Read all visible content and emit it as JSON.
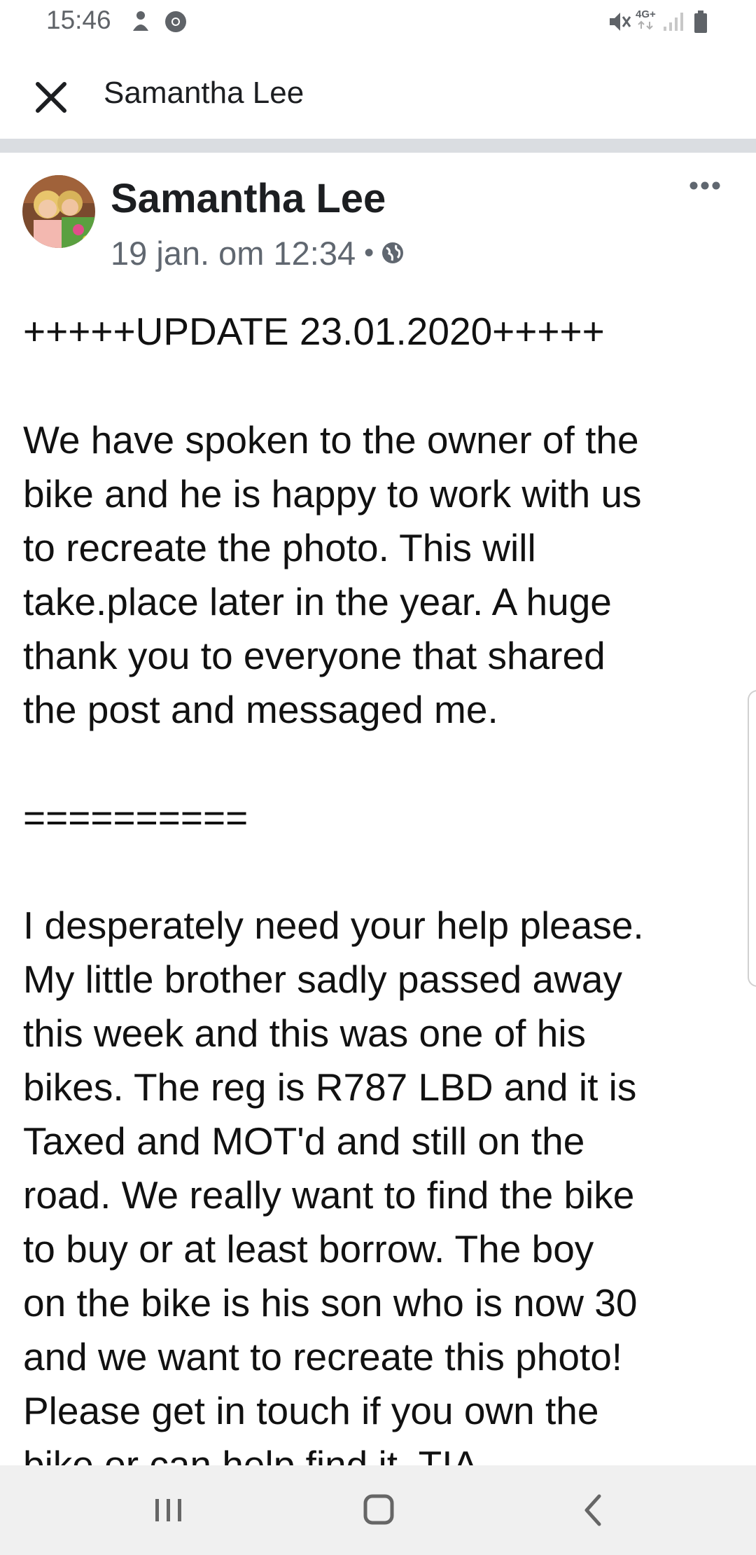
{
  "status_bar": {
    "time": "15:46",
    "left_icons": [
      "notification-icon",
      "chrome-icon"
    ],
    "right_icons": [
      "mute-icon",
      "network-4g-icon",
      "signal-icon",
      "battery-icon"
    ],
    "network_label": "4G+"
  },
  "header": {
    "close_icon": "close-icon",
    "title": "Samantha Lee"
  },
  "post": {
    "author": "Samantha Lee",
    "timestamp": "19 jan. om 12:34",
    "separator": "•",
    "privacy_icon": "globe-icon",
    "more_icon": "more-horizontal-icon",
    "lines": [
      "+++++UPDATE 23.01.2020+++++",
      "",
      "We have spoken to the owner of the",
      "bike and he is happy to work with us",
      "to recreate the photo. This will",
      "take.place later in the year. A huge",
      "thank you to everyone that shared",
      "the post and messaged me.",
      "",
      "==========",
      "",
      "I desperately need your help please.",
      "My little brother sadly passed away",
      "this week and this was one of his",
      "bikes. The reg is R787 LBD and it is",
      "Taxed and MOT'd and still on the",
      "road. We really want to find the bike",
      "to buy or at least borrow. The boy",
      "on the bike is his son who is now 30",
      "and we want to recreate this photo!",
      "Please get in touch if you own the",
      "bike or can help find it. TIA"
    ]
  },
  "nav_bar": {
    "recents_icon": "recents-icon",
    "home_icon": "home-icon",
    "back_icon": "back-icon"
  }
}
